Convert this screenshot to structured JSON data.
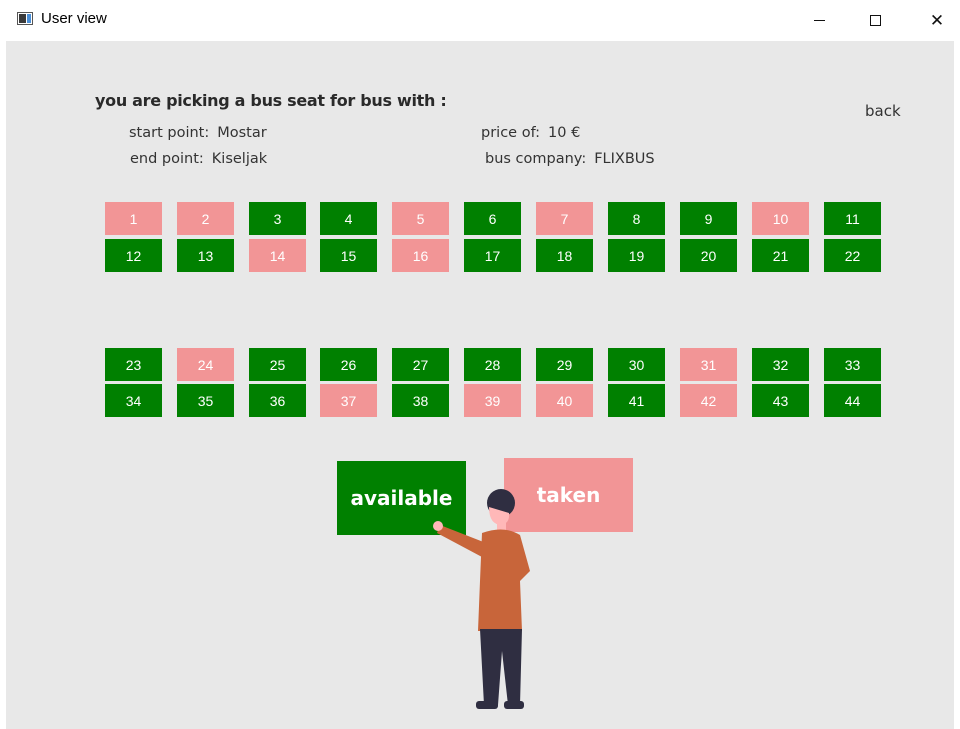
{
  "window": {
    "title": "User view",
    "minimize_icon": "minimize-icon",
    "maximize_icon": "maximize-icon",
    "close_icon": "close-icon",
    "close_glyph": "✕"
  },
  "header": {
    "heading": "you are picking a bus seat for bus with :",
    "back_label": "back"
  },
  "bus_info": {
    "start_label": "start point:",
    "start_value": "Mostar",
    "end_label": "end point:",
    "end_value": "Kiseljak",
    "price_label": "price of:",
    "price_value": "10 €",
    "company_label": "bus company:",
    "company_value": "FLIXBUS"
  },
  "colors": {
    "available": "#008000",
    "taken": "#f29596"
  },
  "seats": [
    {
      "number": "1",
      "status": "taken"
    },
    {
      "number": "2",
      "status": "taken"
    },
    {
      "number": "3",
      "status": "available"
    },
    {
      "number": "4",
      "status": "available"
    },
    {
      "number": "5",
      "status": "taken"
    },
    {
      "number": "6",
      "status": "available"
    },
    {
      "number": "7",
      "status": "taken"
    },
    {
      "number": "8",
      "status": "available"
    },
    {
      "number": "9",
      "status": "available"
    },
    {
      "number": "10",
      "status": "taken"
    },
    {
      "number": "11",
      "status": "available"
    },
    {
      "number": "12",
      "status": "available"
    },
    {
      "number": "13",
      "status": "available"
    },
    {
      "number": "14",
      "status": "taken"
    },
    {
      "number": "15",
      "status": "available"
    },
    {
      "number": "16",
      "status": "taken"
    },
    {
      "number": "17",
      "status": "available"
    },
    {
      "number": "18",
      "status": "available"
    },
    {
      "number": "19",
      "status": "available"
    },
    {
      "number": "20",
      "status": "available"
    },
    {
      "number": "21",
      "status": "available"
    },
    {
      "number": "22",
      "status": "available"
    },
    {
      "number": "23",
      "status": "available"
    },
    {
      "number": "24",
      "status": "taken"
    },
    {
      "number": "25",
      "status": "available"
    },
    {
      "number": "26",
      "status": "available"
    },
    {
      "number": "27",
      "status": "available"
    },
    {
      "number": "28",
      "status": "available"
    },
    {
      "number": "29",
      "status": "available"
    },
    {
      "number": "30",
      "status": "available"
    },
    {
      "number": "31",
      "status": "taken"
    },
    {
      "number": "32",
      "status": "available"
    },
    {
      "number": "33",
      "status": "available"
    },
    {
      "number": "34",
      "status": "available"
    },
    {
      "number": "35",
      "status": "available"
    },
    {
      "number": "36",
      "status": "available"
    },
    {
      "number": "37",
      "status": "taken"
    },
    {
      "number": "38",
      "status": "available"
    },
    {
      "number": "39",
      "status": "taken"
    },
    {
      "number": "40",
      "status": "taken"
    },
    {
      "number": "41",
      "status": "available"
    },
    {
      "number": "42",
      "status": "taken"
    },
    {
      "number": "43",
      "status": "available"
    },
    {
      "number": "44",
      "status": "available"
    }
  ],
  "legend": {
    "available_label": "available",
    "taken_label": "taken"
  }
}
